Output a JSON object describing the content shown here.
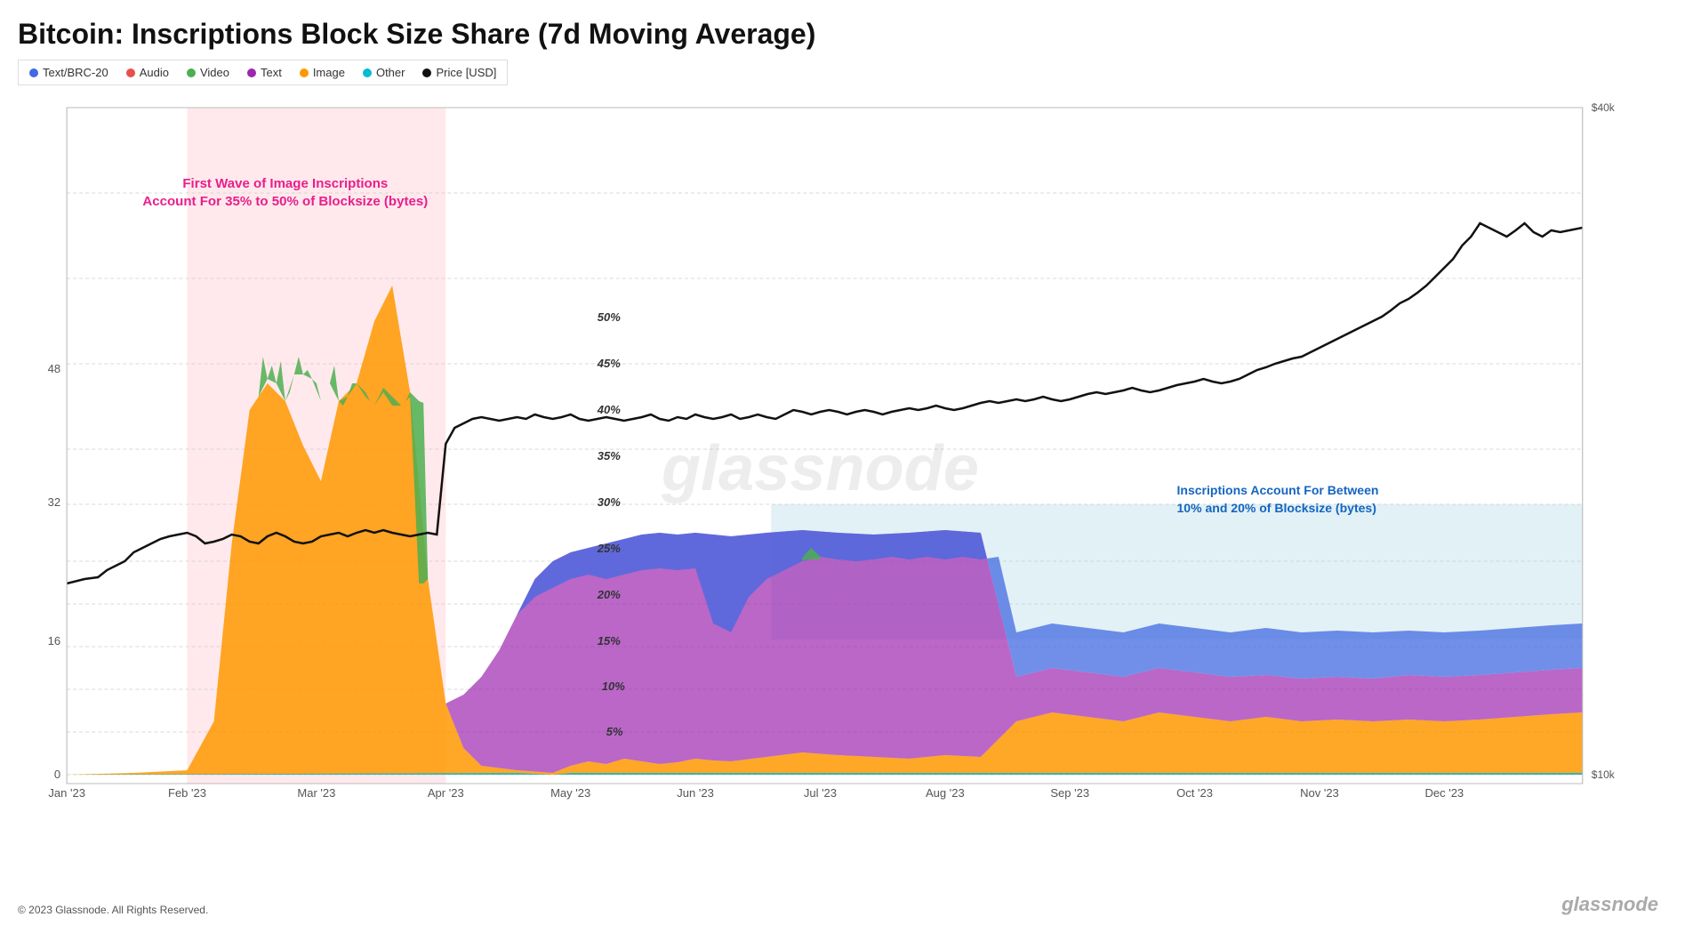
{
  "header": {
    "title": "Bitcoin: Inscriptions Block Size Share (7d Moving Average)"
  },
  "legend": {
    "items": [
      {
        "label": "Text/BRC-20",
        "color": "#4169e1"
      },
      {
        "label": "Audio",
        "color": "#e8504a"
      },
      {
        "label": "Video",
        "color": "#4caf50"
      },
      {
        "label": "Text",
        "color": "#9c27b0"
      },
      {
        "label": "Image",
        "color": "#ff9800"
      },
      {
        "label": "Other",
        "color": "#00bcd4"
      },
      {
        "label": "Price [USD]",
        "color": "#111"
      }
    ]
  },
  "annotations": {
    "pink": "First Wave of Image Inscriptions\nAccount For 35% to 50% of Blocksize (bytes)",
    "blue": "Inscriptions Account For Between\n10% and 20% of Blocksize (bytes)"
  },
  "footer": {
    "copyright": "© 2023 Glassnode. All Rights Reserved.",
    "logo": "glassnode"
  },
  "yAxisLeft": [
    "0",
    "16",
    "32",
    "48"
  ],
  "yAxisRight": [
    "$10k",
    "$40k"
  ],
  "yAxisPercent": [
    "5%",
    "10%",
    "15%",
    "20%",
    "25%",
    "30%",
    "35%",
    "40%",
    "45%",
    "50%"
  ],
  "xAxisLabels": [
    "Jan '23",
    "Feb '23",
    "Mar '23",
    "Apr '23",
    "May '23",
    "Jun '23",
    "Jul '23",
    "Aug '23",
    "Sep '23",
    "Oct '23",
    "Nov '23",
    "Dec '23"
  ]
}
